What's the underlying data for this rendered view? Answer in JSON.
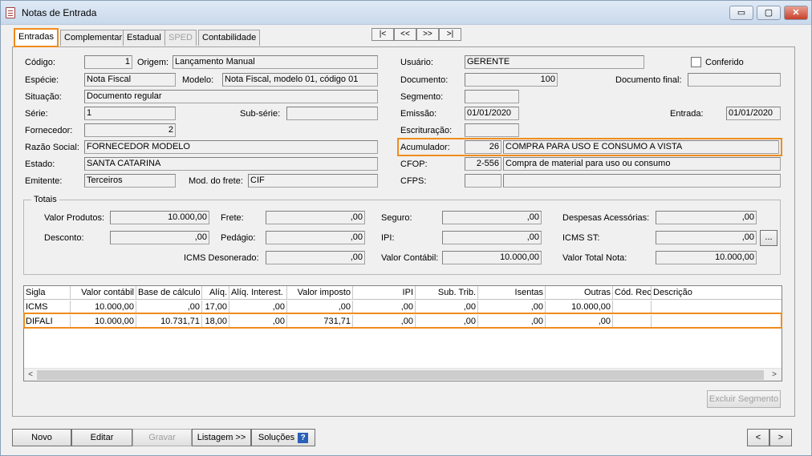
{
  "window": {
    "title": "Notas de Entrada",
    "min_glyph": "▭",
    "max_glyph": "▢",
    "close_glyph": "✕"
  },
  "tabs": [
    {
      "label": "Entradas",
      "state": "active"
    },
    {
      "label": "Complementar",
      "state": "normal"
    },
    {
      "label": "Estadual",
      "state": "normal"
    },
    {
      "label": "SPED",
      "state": "disabled"
    },
    {
      "label": "Contabilidade",
      "state": "normal"
    }
  ],
  "nav": {
    "first": "|<",
    "prev": "<<",
    "next": ">>",
    "last": ">|"
  },
  "form": {
    "codigo_label": "Código:",
    "codigo": "1",
    "origem_label": "Origem:",
    "origem": "Lançamento Manual",
    "especie_label": "Espécie:",
    "especie": "Nota Fiscal",
    "modelo_label": "Modelo:",
    "modelo": "Nota Fiscal, modelo 01, código 01",
    "situacao_label": "Situação:",
    "situacao": "Documento regular",
    "serie_label": "Série:",
    "serie": "1",
    "subserie_label": "Sub-série:",
    "subserie": "",
    "fornecedor_label": "Fornecedor:",
    "fornecedor": "2",
    "razao_label": "Razão Social:",
    "razao": "FORNECEDOR MODELO",
    "estado_label": "Estado:",
    "estado": "SANTA CATARINA",
    "emitente_label": "Emitente:",
    "emitente": "Terceiros",
    "frete_label": "Mod. do frete:",
    "frete": "CIF",
    "usuario_label": "Usuário:",
    "usuario": "GERENTE",
    "conferido_label": "Conferido",
    "documento_label": "Documento:",
    "documento": "100",
    "docfinal_label": "Documento final:",
    "docfinal": "",
    "segmento_label": "Segmento:",
    "segmento": "",
    "emissao_label": "Emissão:",
    "emissao": "01/01/2020",
    "entrada_label": "Entrada:",
    "entrada": "01/01/2020",
    "escrituracao_label": "Escrituração:",
    "escrituracao": "",
    "acumulador_label": "Acumulador:",
    "acumulador_cod": "26",
    "acumulador_desc": "COMPRA PARA USO E CONSUMO A VISTA",
    "cfop_label": "CFOP:",
    "cfop_cod": "2-556",
    "cfop_desc": "Compra de material para uso ou consumo",
    "cfps_label": "CFPS:",
    "cfps_cod": "",
    "cfps_desc": ""
  },
  "totais": {
    "title": "Totais",
    "valor_produtos_label": "Valor Produtos:",
    "valor_produtos": "10.000,00",
    "frete_label": "Frete:",
    "frete": ",00",
    "seguro_label": "Seguro:",
    "seguro": ",00",
    "despesas_label": "Despesas Acessórias:",
    "despesas": ",00",
    "desconto_label": "Desconto:",
    "desconto": ",00",
    "pedagio_label": "Pedágio:",
    "pedagio": ",00",
    "ipi_label": "IPI:",
    "ipi": ",00",
    "icms_st_label": "ICMS ST:",
    "icms_st": ",00",
    "ellipsis": "...",
    "icms_deson_label": "ICMS Desonerado:",
    "icms_deson": ",00",
    "valor_contabil_label": "Valor Contábil:",
    "valor_contabil": "10.000,00",
    "valor_total_label": "Valor Total Nota:",
    "valor_total": "10.000,00"
  },
  "table": {
    "columns": [
      "Sigla",
      "Valor contábil",
      "Base de cálculo",
      "Alíq.",
      "Alíq. Interest.",
      "Valor imposto",
      "IPI",
      "Sub. Trib.",
      "Isentas",
      "Outras",
      "Cód. Rec.",
      "Descrição"
    ],
    "rows": [
      [
        "ICMS",
        "10.000,00",
        ",00",
        "17,00",
        ",00",
        ",00",
        ",00",
        ",00",
        ",00",
        "10.000,00",
        "",
        ""
      ],
      [
        "DIFALI",
        "10.000,00",
        "10.731,71",
        "18,00",
        ",00",
        "731,71",
        ",00",
        ",00",
        ",00",
        ",00",
        "",
        ""
      ]
    ],
    "scroll_left": "<",
    "scroll_right": ">"
  },
  "buttons": {
    "excluir_segmento": "Excluir Segmento",
    "novo": "Novo",
    "editar": "Editar",
    "gravar": "Gravar",
    "listagem": "Listagem >>",
    "solucoes": "Soluções",
    "help": "?",
    "prev": "<",
    "next": ">"
  },
  "colors": {
    "highlight": "#f08c1c",
    "help_icon": "#2a5fb8"
  }
}
